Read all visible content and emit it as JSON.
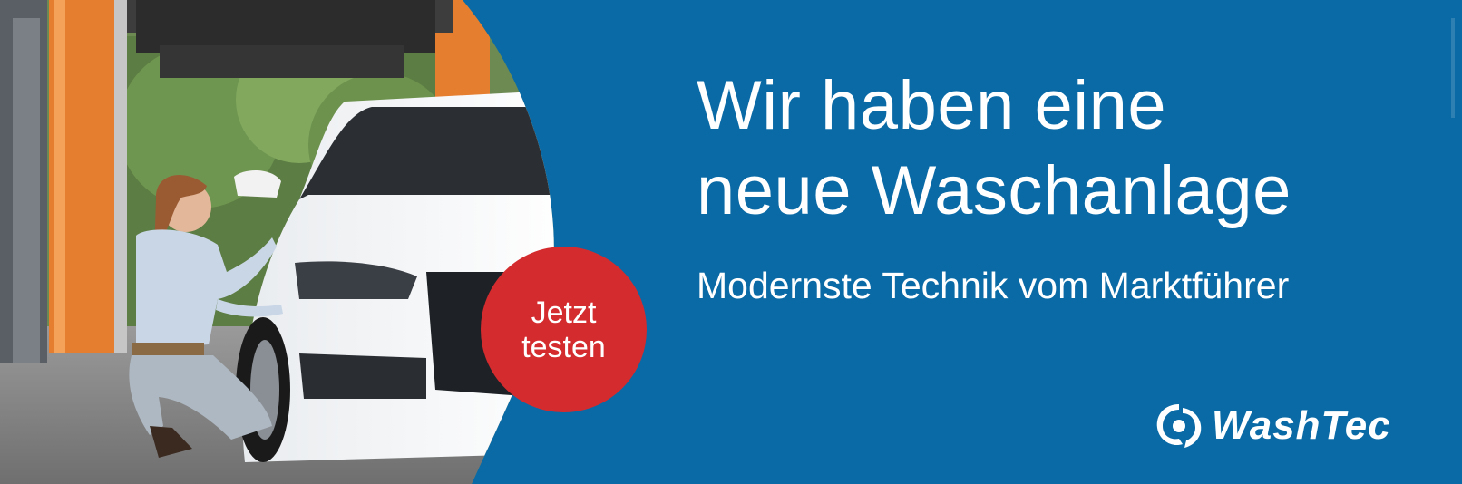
{
  "headline": {
    "line1": "Wir haben eine",
    "line2": "neue Waschanlage"
  },
  "subline": "Modernste Technik vom Marktführer",
  "cta": {
    "line1": "Jetzt",
    "line2": "testen"
  },
  "logo": {
    "text": "WashTec"
  },
  "colors": {
    "background": "#0a6aa6",
    "cta": "#d42b2f",
    "text": "#ffffff"
  }
}
